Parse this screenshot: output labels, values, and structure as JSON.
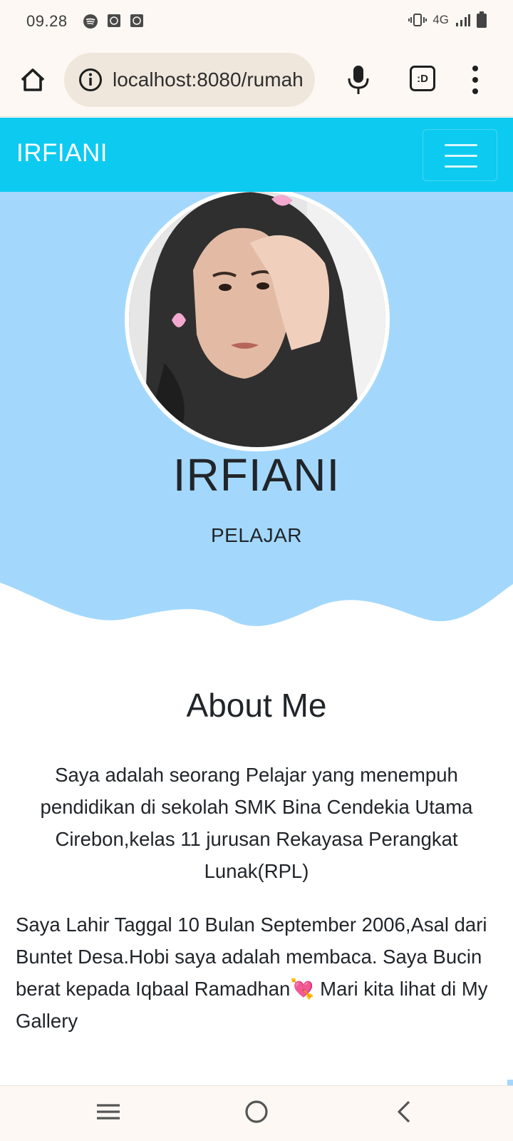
{
  "status_bar": {
    "time": "09.28",
    "network": "4G"
  },
  "browser": {
    "url": "localhost:8080/rumah"
  },
  "navbar": {
    "brand": "IRFIANI"
  },
  "hero": {
    "name": "IRFIANI",
    "job": "PELAJAR"
  },
  "about": {
    "title": "About Me",
    "paragraph1": "Saya adalah seorang Pelajar yang menempuh pendidikan di sekolah SMK Bina Cendekia Utama Cirebon,kelas 11 jurusan Rekayasa Perangkat Lunak(RPL)",
    "paragraph2": "Saya Lahir Taggal 10 Bulan September 2006,Asal dari Buntet Desa.Hobi saya adalah membaca. Saya Bucin berat kepada Iqbaal Ramadhan💘 Mari kita lihat di My Gallery"
  },
  "colors": {
    "navbar": "#0dcaf0",
    "hero_bg": "#a3d8fc",
    "chrome_bg": "#fdf8f3"
  }
}
